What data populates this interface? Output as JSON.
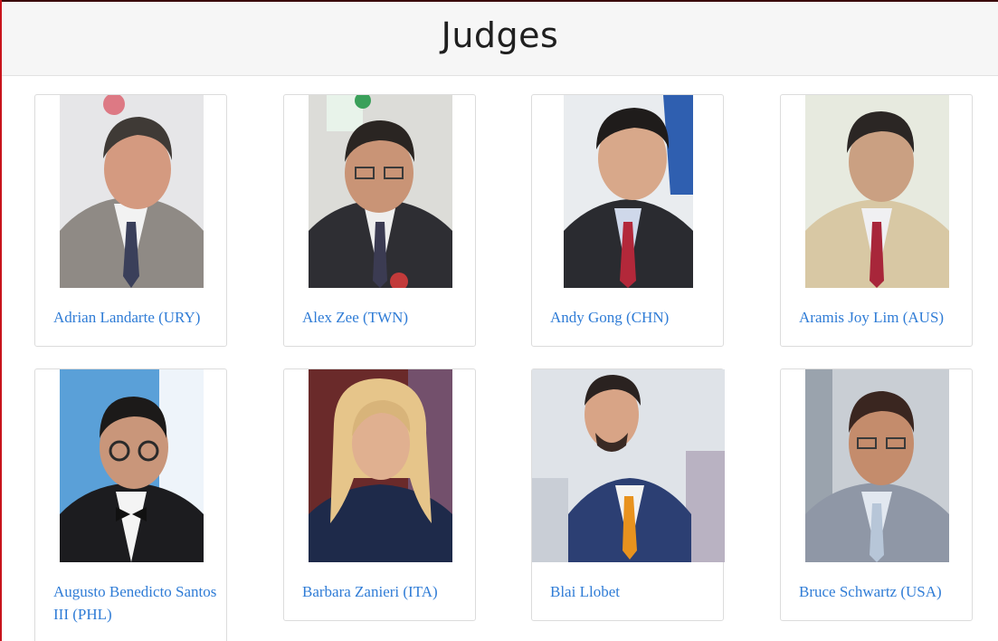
{
  "page": {
    "title": "Judges"
  },
  "judges": [
    {
      "name": "Adrian Landarte (URY)",
      "photo_icon": "judge-portrait"
    },
    {
      "name": "Alex Zee (TWN)",
      "photo_icon": "judge-portrait"
    },
    {
      "name": "Andy Gong (CHN)",
      "photo_icon": "judge-portrait"
    },
    {
      "name": "Aramis Joy Lim (AUS)",
      "photo_icon": "judge-portrait"
    },
    {
      "name": "Augusto Benedicto Santos III (PHL)",
      "photo_icon": "judge-portrait"
    },
    {
      "name": "Barbara Zanieri (ITA)",
      "photo_icon": "judge-portrait"
    },
    {
      "name": "Blai Llobet",
      "photo_icon": "judge-portrait"
    },
    {
      "name": "Bruce Schwartz (USA)",
      "photo_icon": "judge-portrait"
    }
  ],
  "colors": {
    "link": "#2f7cd6",
    "accent_frame": "#c8141c",
    "header_bg": "#f6f6f6"
  }
}
